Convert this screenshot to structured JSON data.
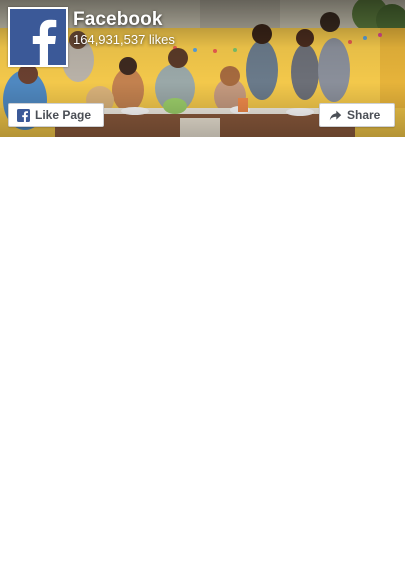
{
  "page": {
    "name": "Facebook",
    "likes": "164,931,537 likes"
  },
  "buttons": {
    "like_label": "Like Page",
    "share_label": "Share"
  },
  "icons": {
    "avatar": "facebook-logo-icon",
    "like": "facebook-f-icon",
    "share": "share-arrow-icon"
  },
  "colors": {
    "brand": "#3b5998",
    "button_text": "#4b4f56",
    "cover_wall": "#f2c64a"
  }
}
